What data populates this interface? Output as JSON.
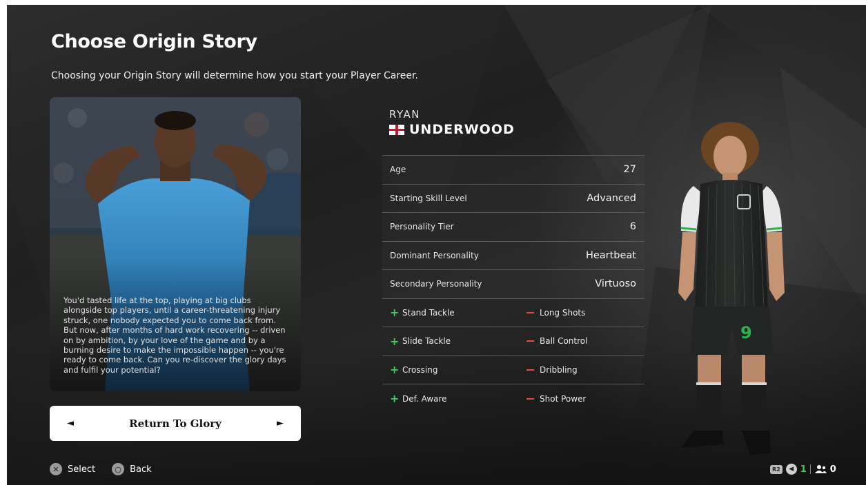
{
  "header": {
    "title": "Choose Origin Story",
    "subtitle": "Choosing your Origin Story will determine how you start your Player Career."
  },
  "story": {
    "description": "You'd tasted life at the top, playing at big clubs alongside top players, until a career-threatening injury struck, one nobody expected you to come back from. But now, after months of hard work recovering -- driven on by ambition, by your love of the game and by a burning desire to make the impossible happen -- you're ready to come back. Can you re-discover the glory days and fulfil your potential?",
    "selected": "Return To Glory",
    "prev_arrow": "◄",
    "next_arrow": "►"
  },
  "player": {
    "first_name": "RYAN",
    "last_name": "UNDERWOOD",
    "nationality_flag": "england-flag-icon",
    "shirt_number": "9",
    "stats": [
      {
        "label": "Age",
        "value": "27"
      },
      {
        "label": "Starting Skill Level",
        "value": "Advanced"
      },
      {
        "label": "Personality Tier",
        "value": "6"
      },
      {
        "label": "Dominant Personality",
        "value": "Heartbeat"
      },
      {
        "label": "Secondary Personality",
        "value": "Virtuoso"
      }
    ],
    "traits": [
      {
        "plus": "Stand Tackle",
        "minus": "Long Shots"
      },
      {
        "plus": "Slide Tackle",
        "minus": "Ball Control"
      },
      {
        "plus": "Crossing",
        "minus": "Dribbling"
      },
      {
        "plus": "Def. Aware",
        "minus": "Shot Power"
      }
    ],
    "plus_symbol": "+"
  },
  "footer": {
    "select_label": "Select",
    "back_label": "Back",
    "select_glyph": "✕",
    "back_glyph": "○",
    "r2_label": "R2",
    "mic_glyph": "◀",
    "voice_count": "1",
    "party_count": "0"
  },
  "colors": {
    "plus": "#35d05a",
    "minus": "#f0473a",
    "kit_trim": "#2cb24a"
  }
}
